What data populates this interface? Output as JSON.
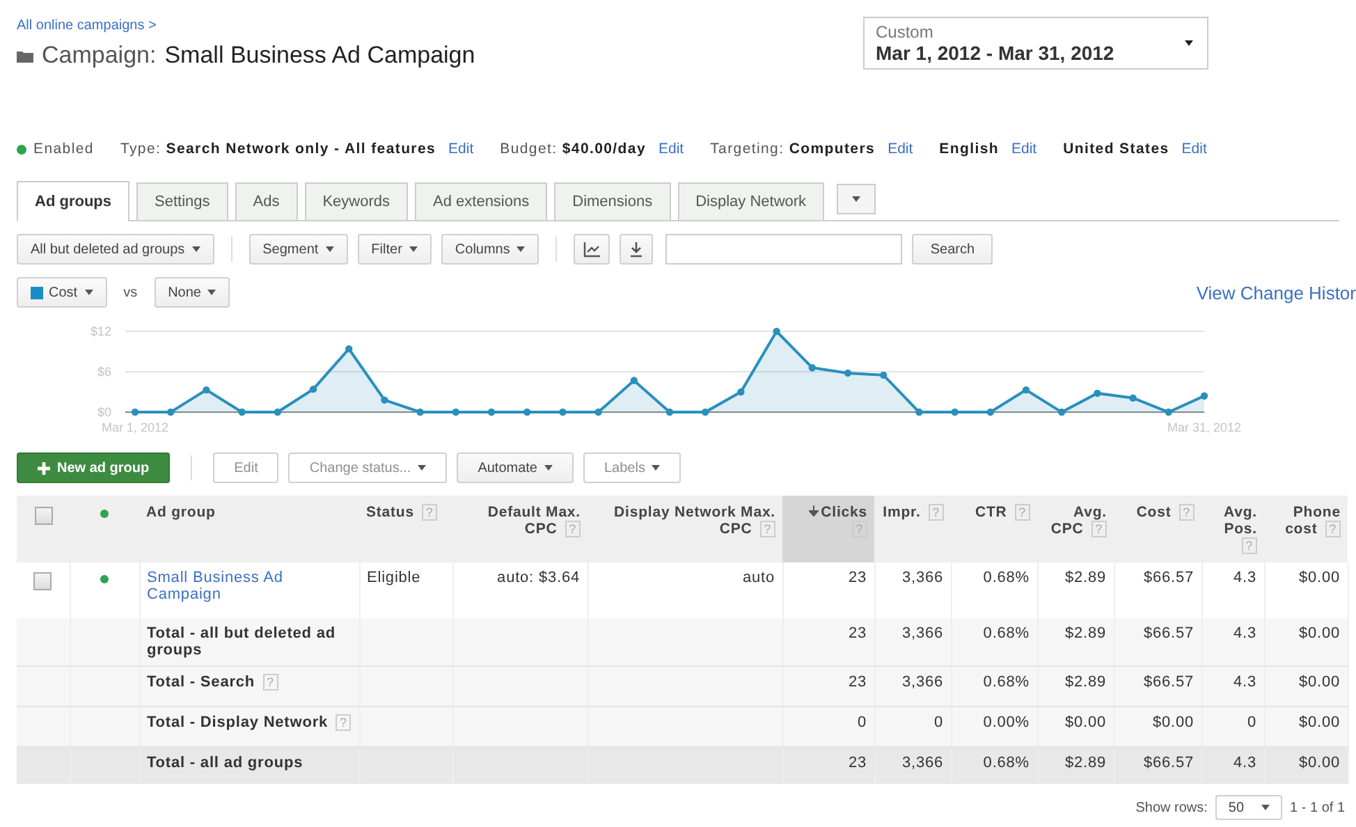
{
  "header": {
    "breadcrumb": "All online campaigns >",
    "title_label": "Campaign:",
    "title": "Small Business Ad Campaign",
    "date_range": {
      "label": "Custom",
      "value": "Mar 1, 2012 - Mar 31, 2012"
    }
  },
  "status_line": {
    "state": {
      "label": "Enabled",
      "color": "#2da44e"
    },
    "settings": [
      {
        "text": "Type: **Search Network only - All features**",
        "edit": "Edit"
      },
      {
        "text": "Budget: **$40.00/day**",
        "edit": "Edit"
      },
      {
        "text": "Targeting: **Computers**",
        "edit": "Edit"
      },
      {
        "text": "**English**",
        "edit": "Edit"
      },
      {
        "text": "**United States**",
        "edit": "Edit"
      }
    ]
  },
  "tabs": [
    {
      "label": "Ad groups",
      "selected": true
    },
    {
      "label": "Settings",
      "selected": false
    },
    {
      "label": "Ads",
      "selected": false
    },
    {
      "label": "Keywords",
      "selected": false
    },
    {
      "label": "Ad extensions",
      "selected": false
    },
    {
      "label": "Dimensions",
      "selected": false
    },
    {
      "label": "Display Network",
      "selected": false
    },
    {
      "kind": "more",
      "selected": false
    }
  ],
  "toolbar": {
    "dropdowns": [
      "All but deleted ad groups",
      "Segment",
      "Filter",
      "Columns"
    ],
    "search_button": "Search"
  },
  "chart_controls": {
    "metric": {
      "color": "#1a8cc8"
    },
    "vs": "vs",
    "compare": "None",
    "history_link": "View Change Histor"
  },
  "chart_data": {
    "type": "area",
    "categories": [
      "Mar 1, 2012",
      null,
      null,
      null,
      null,
      null,
      null,
      null,
      null,
      null,
      null,
      null,
      null,
      null,
      null,
      null,
      null,
      null,
      null,
      null,
      null,
      null,
      null,
      null,
      null,
      null,
      null,
      null,
      null,
      null,
      "Mar 31, 2012"
    ],
    "series": [
      {
        "name": "Cost",
        "color": "#2a8fbd",
        "values": [
          0,
          0,
          3.3,
          0,
          0,
          3.4,
          9.4,
          1.8,
          0,
          0,
          0,
          0,
          0,
          0,
          4.7,
          0,
          0,
          3.0,
          12,
          6.6,
          5.8,
          5.5,
          0,
          0,
          0,
          3.3,
          0,
          2.8,
          2.1,
          0,
          2.4
        ]
      }
    ],
    "ylim": [
      0,
      12
    ],
    "yticks": [
      {
        "value": 0,
        "label": "$0"
      },
      {
        "value": 6,
        "label": "$6"
      },
      {
        "value": 12,
        "label": "$12"
      }
    ]
  },
  "actions": [
    {
      "kind": "primary",
      "label": "New ad group",
      "disabled": false
    },
    {
      "kind": "plain",
      "label": "Edit",
      "disabled": true
    },
    {
      "kind": "dropdown",
      "label": "Change status...",
      "disabled": true
    },
    {
      "kind": "dropdown",
      "label": "Automate",
      "disabled": false
    },
    {
      "kind": "dropdown",
      "label": "Labels",
      "disabled": true
    }
  ],
  "table": {
    "header": {
      "checked": false,
      "color": "#2da44e"
    },
    "columns": [
      {
        "label": "Ad group",
        "sorted": false
      },
      {
        "label": "Status",
        "help": "?",
        "sorted": false
      },
      {
        "label": "Default Max. CPC",
        "help": "?",
        "sorted": false
      },
      {
        "label": "Display Network Max. CPC",
        "help": "?",
        "sorted": false
      },
      {
        "label": "Clicks",
        "help": "?",
        "sorted": true
      },
      {
        "label": "Impr.",
        "help": "?",
        "sorted": false
      },
      {
        "label": "CTR",
        "help": "?",
        "sorted": false
      },
      {
        "label": "Avg. CPC",
        "help": "?",
        "sorted": false
      },
      {
        "label": "Cost",
        "help": "?",
        "sorted": false
      },
      {
        "label": "Avg. Pos.",
        "help": "?",
        "sorted": false
      },
      {
        "label": "Phone cost",
        "help": "?",
        "sorted": false
      }
    ],
    "rows": [
      {
        "kind": "item",
        "checked": false,
        "color": "#2da44e",
        "name": "Small Business Ad Campaign",
        "status": "Eligible",
        "default_cpc": "auto: $3.64",
        "display_cpc": "auto",
        "stats": [
          "23",
          "3,366",
          "0.68%",
          "$2.89",
          "$66.57",
          "4.3",
          "$0.00"
        ]
      },
      {
        "kind": "total",
        "label": "Total - all but deleted ad groups",
        "stats": [
          "23",
          "3,366",
          "0.68%",
          "$2.89",
          "$66.57",
          "4.3",
          "$0.00"
        ]
      },
      {
        "kind": "total",
        "label": "Total - Search",
        "help": "?",
        "stats": [
          "23",
          "3,366",
          "0.68%",
          "$2.89",
          "$66.57",
          "4.3",
          "$0.00"
        ]
      },
      {
        "kind": "total",
        "label": "Total - Display Network",
        "help": "?",
        "stats": [
          "0",
          "0",
          "0.00%",
          "$0.00",
          "$0.00",
          "0",
          "$0.00"
        ]
      },
      {
        "kind": "grand",
        "label": "Total - all ad groups",
        "stats": [
          "23",
          "3,366",
          "0.68%",
          "$2.89",
          "$66.57",
          "4.3",
          "$0.00"
        ]
      }
    ]
  },
  "footer": {
    "label": "Show rows:",
    "page_size": "50",
    "range": "1 - 1 of 1"
  }
}
